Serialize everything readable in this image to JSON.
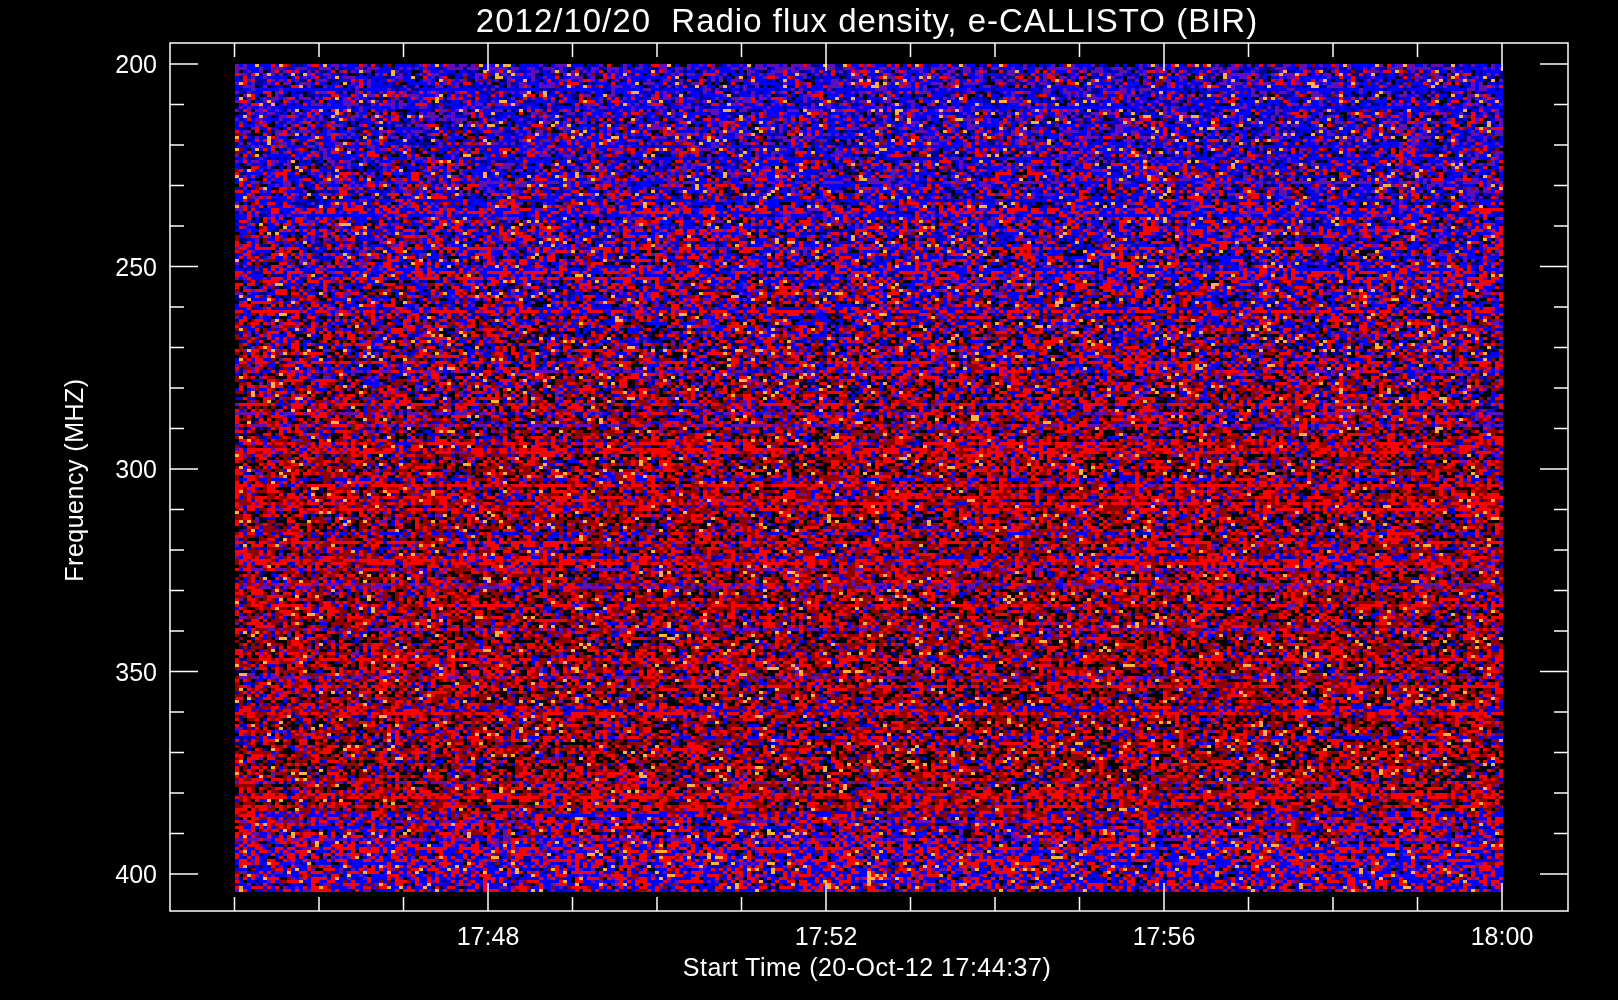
{
  "title": "2012/10/20  Radio flux density, e-CALLISTO (BIR)",
  "y_axis": {
    "label": "Frequency (MHZ)",
    "ticks": [
      "200",
      "250",
      "300",
      "350",
      "400"
    ]
  },
  "x_axis": {
    "label": "Start Time (20-Oct-12 17:44:37)",
    "ticks": [
      "17:48",
      "17:52",
      "17:56",
      "18:00"
    ]
  }
}
